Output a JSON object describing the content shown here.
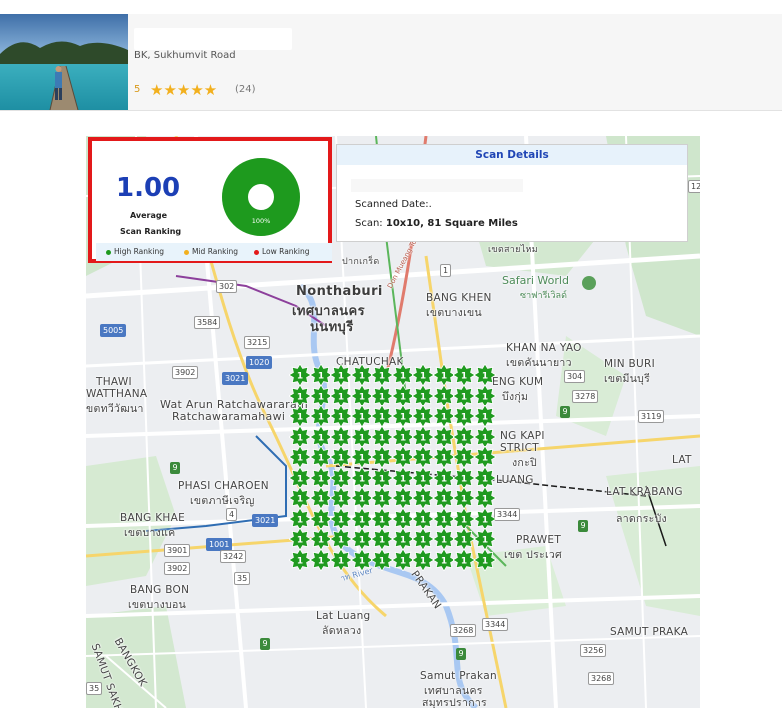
{
  "business": {
    "address": "BK, Sukhumvit Road",
    "rating": "5",
    "stars": "★★★★★",
    "review_count": "(24)"
  },
  "summary": {
    "average_value": "1.00",
    "average_label_line1": "Average",
    "average_label_line2": "Scan Ranking",
    "donut_percent_label": "100%",
    "donut_fraction_high": 1.0,
    "legend": [
      {
        "label": "High Ranking",
        "color": "#1e9a1e"
      },
      {
        "label": "Mid Ranking",
        "color": "#f2b01e"
      },
      {
        "label": "Low Ranking",
        "color": "#e3191a"
      }
    ]
  },
  "details": {
    "title": "Scan Details",
    "scanned_date_label": "Scanned Date:.",
    "scan_prefix": "Scan: ",
    "scan_value": "10x10, 81 Square Miles"
  },
  "grid": {
    "rows": 10,
    "cols": 10,
    "rank_value": "1",
    "marker_color": "#1f9a1f"
  },
  "map_labels": {
    "nonthaburi_en": "Nonthaburi",
    "nonthaburi_th": "เทศบาลนคร",
    "nonthaburi_th2": "นนทบุรี",
    "chatuchak": "CHATUCHAK",
    "bang_khen": "BANG KHEN",
    "bang_khen_th": "เขตบางเขน",
    "safari_world": "Safari World",
    "safari_world_th": "ซาฟารีเวิลด์",
    "khan_na_yao": "KHAN NA YAO",
    "khan_na_yao_th": "เขตคันนายาว",
    "min_buri": "MIN BURI",
    "min_buri_th": "เขตมีนบุรี",
    "thawi_watthana": "THAWI",
    "thawi_watthana2": "WATTHANA",
    "thawi_th": "ขตทวีวัฒนา",
    "wat_arun": "Wat Arun Ratchawararam",
    "wat_arun2": "Ratchawaramahawi",
    "bueng_kum": "ENG KUM",
    "bueng_kum_th": "บึงกุ่ม",
    "bang_kapi": "NG KAPI",
    "bang_kapi2": "STRICT",
    "bang_kapi_th": "งกะปิ",
    "phasi_charoen": "PHASI CHAROEN",
    "phasi_charoen_th": "เขตภาษีเจริญ",
    "bang_khae": "BANG KHAE",
    "bang_khae_th": "เขตบางแค",
    "lat_krabang": "LAT KRABANG",
    "lat_krabang_th": "ลาดกระบัง",
    "lat": "LAT",
    "luang": "LUANG",
    "prawet": "PRAWET",
    "prawet_th": "เขต ประเวศ",
    "bang_bon": "BANG BON",
    "bang_bon_th": "เขตบางบอน",
    "lat_luang": "Lat Luang",
    "lat_luang_th": "ลัดหลวง",
    "prakan": "PRAKAN",
    "samut_prakan_en": "SAMUT PRAKA",
    "samut_prakan": "Samut Prakan",
    "samut_prakan_th": "เทศบาลนคร",
    "samut_prakan_th2": "สมุทรปราการ",
    "samut_sakhon": "SAMUT SAKHO",
    "bangkok": "BANGKOK",
    "pak_kret": "ปากเกร็ด",
    "sai_mai": "เขตสายไหม",
    "don_mueang_road": "Don Mueang Toll Way",
    "river": "าท River"
  },
  "road_shields": [
    "302",
    "3584",
    "3215",
    "1020",
    "3021",
    "5005",
    "3902",
    "304",
    "3278",
    "3119",
    "4",
    "3021",
    "1001",
    "3901",
    "3242",
    "3902",
    "35",
    "3344",
    "3268",
    "3344",
    "3256",
    "3268",
    "1",
    "35",
    "12"
  ]
}
